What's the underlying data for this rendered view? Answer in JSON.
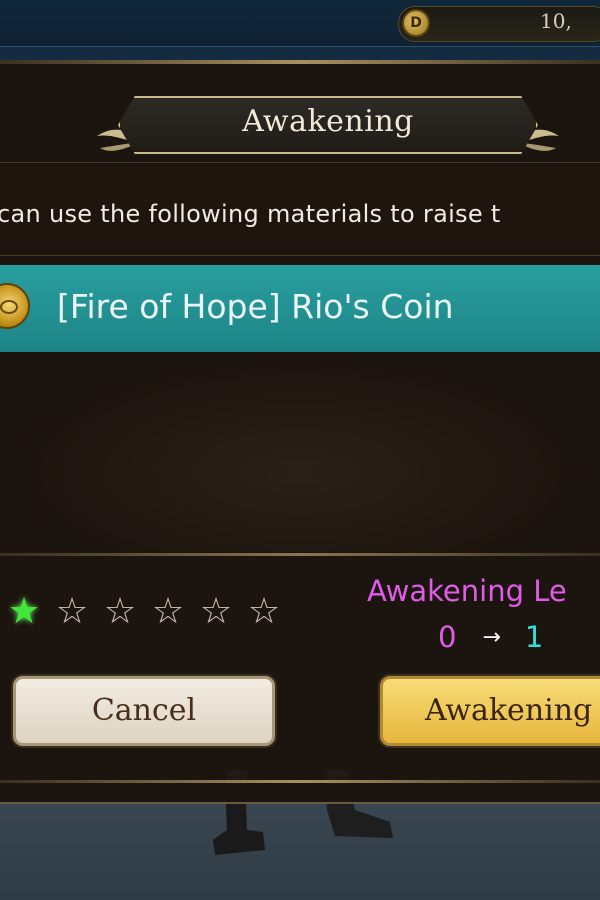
{
  "header": {
    "currency_icon_label": "D",
    "currency_amount": "10,"
  },
  "dialog": {
    "title": "Awakening",
    "description": "can use the following materials to raise t",
    "item": {
      "name": "[Fire of Hope] Rio's Coin",
      "icon": "coin-icon"
    },
    "stars": {
      "filled": 1,
      "total": 6,
      "filled_glyph": "★",
      "empty_glyph": "☆"
    },
    "level": {
      "label": "Awakening Le",
      "from": "0",
      "arrow": "→",
      "to": "1"
    },
    "buttons": {
      "cancel": "Cancel",
      "confirm": "Awakening"
    },
    "colors": {
      "item_bar": "#2a9ea0",
      "level_label": "#e05ce8",
      "level_to": "#2ee0d8",
      "star_filled": "#3ee83a",
      "confirm_button": "#f0c850"
    }
  }
}
